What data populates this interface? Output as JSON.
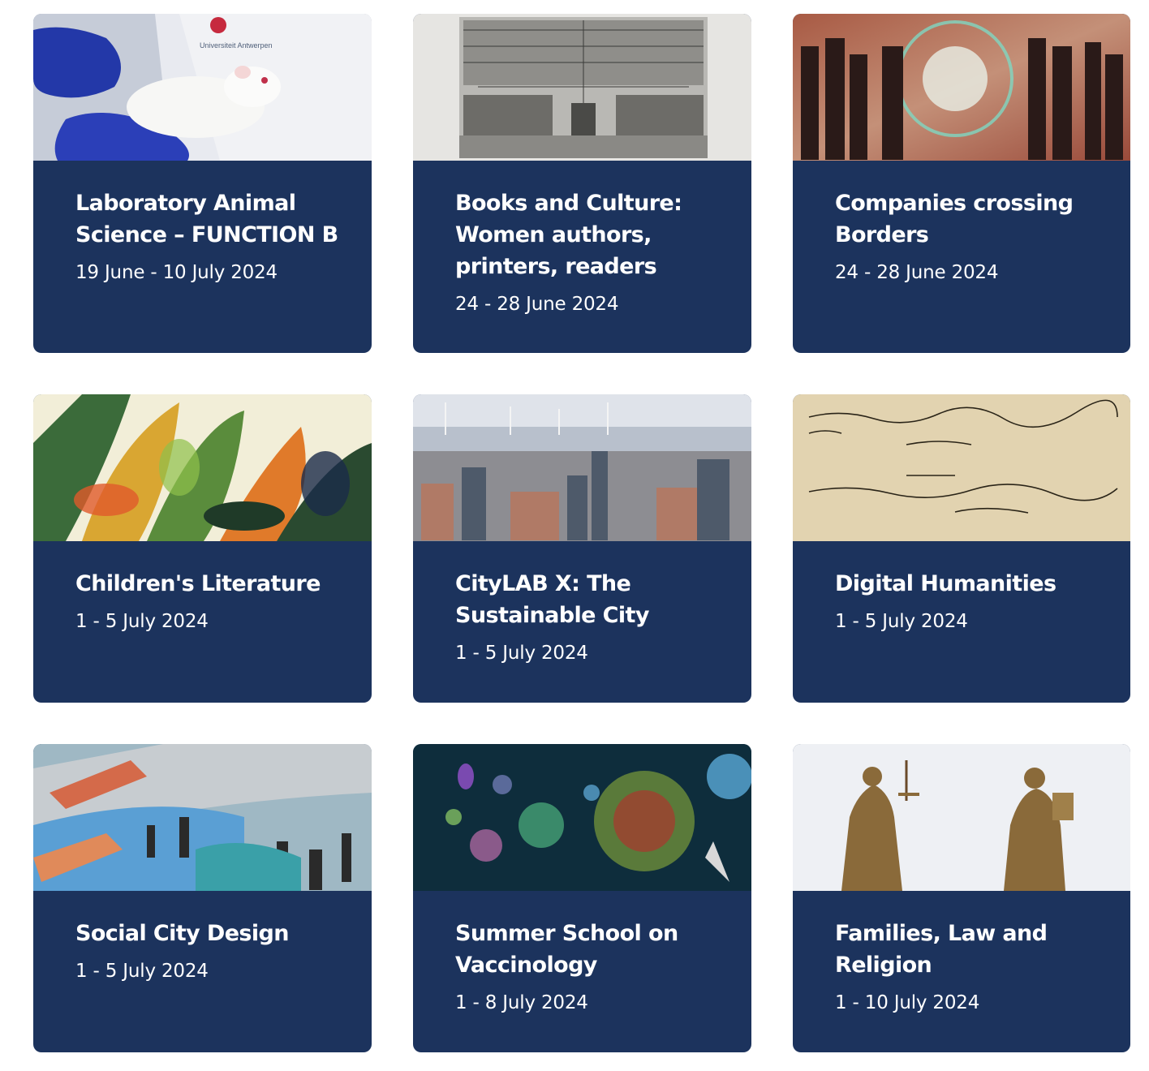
{
  "courses": [
    {
      "title": "Laboratory Animal Science – FUNCTION B",
      "date": "19 June - 10 July 2024",
      "image_icon": "lab-rat-photo",
      "image_caption": "Universiteit Antwerpen"
    },
    {
      "title": "Books and Culture: Women authors, printers, readers",
      "date": "24 - 28 June 2024",
      "image_icon": "engraving-print-shop"
    },
    {
      "title": "Companies crossing Borders",
      "date": "24 - 28 June 2024",
      "image_icon": "business-globe-silhouettes"
    },
    {
      "title": "Children's Literature",
      "date": "1 - 5 July 2024",
      "image_icon": "jungle-watercolor"
    },
    {
      "title": "CityLAB X: The Sustainable City",
      "date": "1 - 5 July 2024",
      "image_icon": "city-skyline-wind-turbines"
    },
    {
      "title": "Digital Humanities",
      "date": "1 - 5 July 2024",
      "image_icon": "handwritten-manuscript"
    },
    {
      "title": "Social City Design",
      "date": "1 - 5 July 2024",
      "image_icon": "urban-playground"
    },
    {
      "title": "Summer School on Vaccinology",
      "date": "1 - 8 July 2024",
      "image_icon": "virus-illustration"
    },
    {
      "title": "Families, Law and Religion",
      "date": "1 - 10 July 2024",
      "image_icon": "justice-and-moses-statues"
    }
  ],
  "colors": {
    "card_background": "#1c335d",
    "card_text": "#ffffff",
    "page_background": "#ffffff"
  }
}
